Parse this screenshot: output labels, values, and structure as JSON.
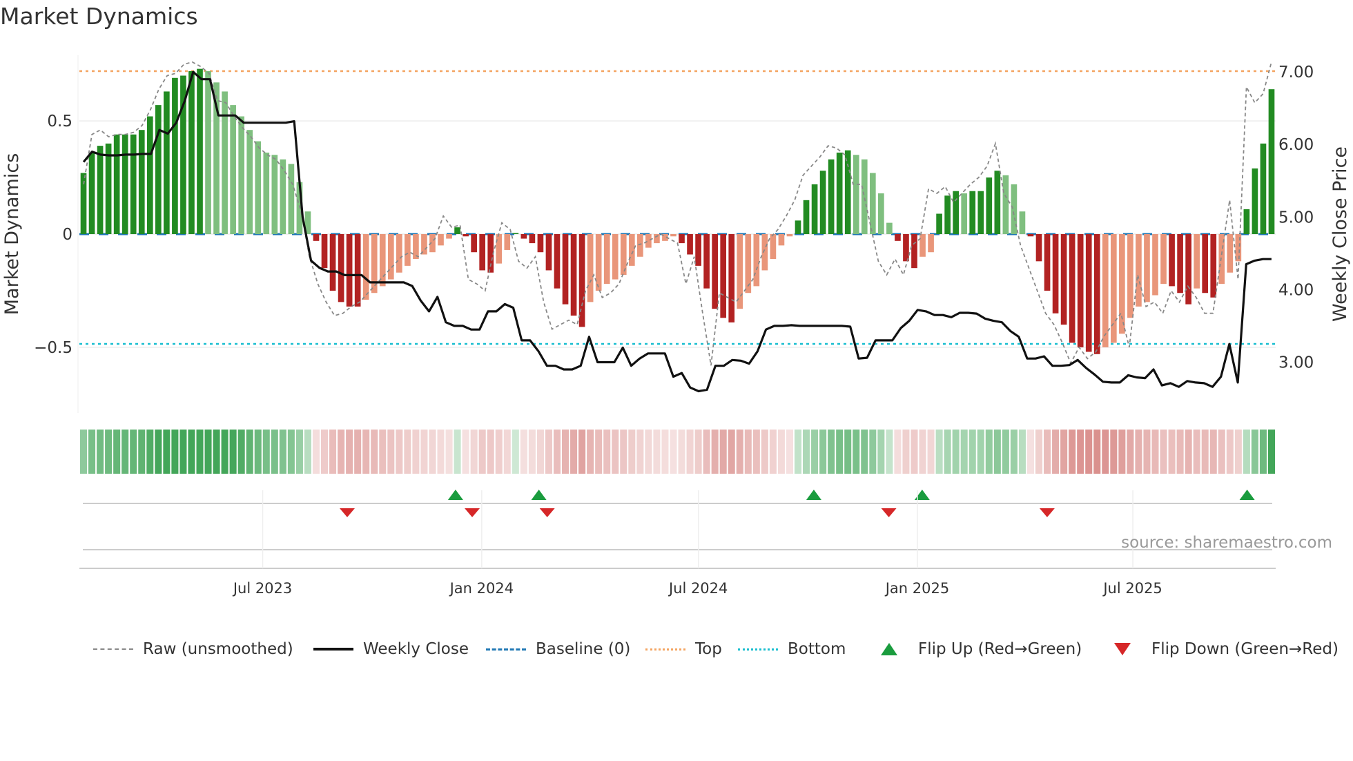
{
  "title": "Market Dynamics",
  "source": "source: sharemaestro.com",
  "colors": {
    "green_dark": "#228b22",
    "green_light": "#7fbf7f",
    "red_dark": "#b22222",
    "red_light": "#e9967a",
    "close": "#111111",
    "raw": "#888888",
    "baseline": "#1f77b4",
    "top": "#f4a460",
    "bottom": "#17becf",
    "flip_up": "#1a9c3e",
    "flip_down": "#d62728"
  },
  "chart_data": {
    "type": "bar",
    "title": "Market Dynamics",
    "ylabel": "Market Dynamics",
    "y2label": "Weekly Close Price",
    "ylim": [
      -0.79,
      0.79
    ],
    "y2lim": [
      2.3,
      7.23
    ],
    "yticks": [
      {
        "v": 0.5,
        "label": "0.5"
      },
      {
        "v": 0,
        "label": "0"
      },
      {
        "v": -0.5,
        "label": "−0.5"
      }
    ],
    "y2ticks": [
      {
        "v": 7,
        "label": "7.00"
      },
      {
        "v": 6,
        "label": "6.00"
      },
      {
        "v": 5,
        "label": "5.00"
      },
      {
        "v": 4,
        "label": "4.00"
      },
      {
        "v": 3,
        "label": "3.00"
      }
    ],
    "date_range": [
      "2023-01-28",
      "2025-10-29"
    ],
    "xticks": [
      {
        "date": "2023-07-01",
        "label": "Jul 2023"
      },
      {
        "date": "2024-01-01",
        "label": "Jan 2024"
      },
      {
        "date": "2024-07-01",
        "label": "Jul 2024"
      },
      {
        "date": "2025-01-01",
        "label": "Jan 2025"
      },
      {
        "date": "2025-07-01",
        "label": "Jul 2025"
      }
    ],
    "top_level": 0.72,
    "bottom_level": -0.485,
    "baseline": 0,
    "momentum": [
      0.27,
      0.36,
      0.39,
      0.4,
      0.44,
      0.44,
      0.44,
      0.46,
      0.52,
      0.57,
      0.63,
      0.69,
      0.7,
      0.72,
      0.73,
      0.72,
      0.67,
      0.63,
      0.57,
      0.52,
      0.46,
      0.41,
      0.36,
      0.35,
      0.33,
      0.31,
      0.23,
      0.1,
      -0.03,
      -0.15,
      -0.25,
      -0.3,
      -0.32,
      -0.32,
      -0.29,
      -0.26,
      -0.23,
      -0.2,
      -0.17,
      -0.14,
      -0.11,
      -0.09,
      -0.08,
      -0.05,
      -0.02,
      0.03,
      -0.01,
      -0.08,
      -0.16,
      -0.17,
      -0.13,
      -0.07,
      0.005,
      -0.02,
      -0.04,
      -0.08,
      -0.16,
      -0.24,
      -0.31,
      -0.36,
      -0.41,
      -0.3,
      -0.25,
      -0.22,
      -0.2,
      -0.18,
      -0.14,
      -0.1,
      -0.06,
      -0.04,
      -0.03,
      -0.01,
      -0.04,
      -0.09,
      -0.14,
      -0.24,
      -0.33,
      -0.37,
      -0.39,
      -0.33,
      -0.26,
      -0.23,
      -0.16,
      -0.11,
      -0.05,
      -0.01,
      0.06,
      0.15,
      0.22,
      0.28,
      0.33,
      0.36,
      0.37,
      0.35,
      0.33,
      0.27,
      0.18,
      0.05,
      -0.03,
      -0.12,
      -0.15,
      -0.1,
      -0.08,
      0.09,
      0.17,
      0.19,
      0.18,
      0.19,
      0.19,
      0.25,
      0.28,
      0.26,
      0.22,
      0.1,
      -0.01,
      -0.12,
      -0.25,
      -0.35,
      -0.4,
      -0.48,
      -0.5,
      -0.52,
      -0.53,
      -0.5,
      -0.48,
      -0.44,
      -0.37,
      -0.32,
      -0.3,
      -0.27,
      -0.22,
      -0.23,
      -0.26,
      -0.31,
      -0.24,
      -0.26,
      -0.28,
      -0.22,
      -0.17,
      -0.12,
      0.11,
      0.29,
      0.4,
      0.64
    ],
    "raw": [
      0.22,
      0.44,
      0.46,
      0.43,
      0.44,
      0.44,
      0.45,
      0.48,
      0.55,
      0.64,
      0.7,
      0.71,
      0.75,
      0.76,
      0.74,
      0.71,
      0.59,
      0.58,
      0.52,
      0.47,
      0.43,
      0.38,
      0.35,
      0.33,
      0.28,
      0.22,
      0.1,
      -0.1,
      -0.22,
      -0.3,
      -0.36,
      -0.35,
      -0.32,
      -0.3,
      -0.26,
      -0.22,
      -0.18,
      -0.14,
      -0.1,
      -0.08,
      -0.1,
      -0.06,
      -0.02,
      0.08,
      0.03,
      0.04,
      -0.2,
      -0.22,
      -0.25,
      -0.08,
      0.05,
      0.02,
      -0.12,
      -0.15,
      -0.1,
      -0.3,
      -0.42,
      -0.4,
      -0.38,
      -0.4,
      -0.25,
      -0.18,
      -0.28,
      -0.26,
      -0.22,
      -0.13,
      -0.05,
      -0.04,
      -0.02,
      0.0,
      -0.02,
      -0.04,
      -0.22,
      -0.1,
      -0.35,
      -0.58,
      -0.26,
      -0.28,
      -0.3,
      -0.25,
      -0.2,
      -0.1,
      -0.02,
      0.02,
      0.08,
      0.15,
      0.26,
      0.3,
      0.34,
      0.39,
      0.38,
      0.35,
      0.22,
      0.22,
      0.05,
      -0.12,
      -0.18,
      -0.11,
      -0.18,
      -0.05,
      -0.02,
      0.2,
      0.18,
      0.21,
      0.14,
      0.18,
      0.22,
      0.25,
      0.3,
      0.4,
      0.18,
      0.12,
      -0.05,
      -0.15,
      -0.25,
      -0.35,
      -0.4,
      -0.48,
      -0.57,
      -0.5,
      -0.55,
      -0.52,
      -0.45,
      -0.4,
      -0.35,
      -0.5,
      -0.18,
      -0.32,
      -0.3,
      -0.35,
      -0.25,
      -0.3,
      -0.23,
      -0.28,
      -0.35,
      -0.35,
      -0.1,
      0.15,
      -0.2,
      0.65,
      0.58,
      0.62,
      0.76
    ],
    "close": [
      5.76,
      5.9,
      5.86,
      5.85,
      5.85,
      5.86,
      5.86,
      5.87,
      5.87,
      6.2,
      6.15,
      6.3,
      6.6,
      7.0,
      6.9,
      6.9,
      6.4,
      6.4,
      6.4,
      6.3,
      6.3,
      6.3,
      6.3,
      6.3,
      6.3,
      6.32,
      5.0,
      4.4,
      4.3,
      4.25,
      4.25,
      4.2,
      4.2,
      4.2,
      4.1,
      4.1,
      4.1,
      4.1,
      4.1,
      4.05,
      3.85,
      3.7,
      3.9,
      3.55,
      3.5,
      3.5,
      3.45,
      3.45,
      3.7,
      3.7,
      3.8,
      3.75,
      3.3,
      3.3,
      3.15,
      2.95,
      2.95,
      2.9,
      2.9,
      2.95,
      3.35,
      3.0,
      3.0,
      3.0,
      3.2,
      2.95,
      3.05,
      3.12,
      3.12,
      3.12,
      2.8,
      2.85,
      2.65,
      2.6,
      2.62,
      2.95,
      2.95,
      3.03,
      3.02,
      2.98,
      3.15,
      3.45,
      3.5,
      3.5,
      3.51,
      3.5,
      3.5,
      3.5,
      3.5,
      3.5,
      3.5,
      3.49,
      3.05,
      3.06,
      3.3,
      3.3,
      3.3,
      3.47,
      3.57,
      3.72,
      3.7,
      3.65,
      3.65,
      3.62,
      3.68,
      3.68,
      3.67,
      3.6,
      3.57,
      3.55,
      3.43,
      3.35,
      3.05,
      3.05,
      3.08,
      2.95,
      2.95,
      2.96,
      3.03,
      2.92,
      2.83,
      2.73,
      2.72,
      2.72,
      2.82,
      2.79,
      2.78,
      2.9,
      2.68,
      2.71,
      2.66,
      2.74,
      2.72,
      2.71,
      2.66,
      2.8,
      3.25,
      2.72,
      4.35,
      4.4,
      4.42,
      4.42
    ],
    "flip_up": [
      "2023-12-10",
      "2024-02-18",
      "2024-10-06",
      "2025-01-05",
      "2025-10-05"
    ],
    "flip_down": [
      "2023-09-10",
      "2023-12-24",
      "2024-02-25",
      "2024-12-08",
      "2025-04-20"
    ],
    "legend": [
      {
        "key": "raw",
        "label": "Raw (unsmoothed)"
      },
      {
        "key": "close",
        "label": "Weekly Close"
      },
      {
        "key": "baseline",
        "label": "Baseline (0)"
      },
      {
        "key": "top",
        "label": "Top"
      },
      {
        "key": "bottom",
        "label": "Bottom"
      },
      {
        "key": "flip_up",
        "label": "Flip Up (Red→Green)"
      },
      {
        "key": "flip_down",
        "label": "Flip Down (Green→Red)"
      }
    ]
  }
}
